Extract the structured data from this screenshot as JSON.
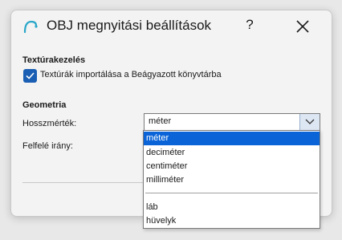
{
  "window": {
    "title": "OBJ megnyitási beállítások",
    "help_label": "?",
    "icon": "app-arc-icon",
    "close_icon": "close-icon"
  },
  "textures": {
    "heading": "Textúrakezelés",
    "checkbox_label": "Textúrák importálása a Beágyazott könyvtárba",
    "checked": true
  },
  "geometry": {
    "heading": "Geometria",
    "units_label": "Hosszmérték:",
    "up_label": "Felfelé irány:",
    "units_value": "méter",
    "dropdown_icon": "chevron-down-icon",
    "options": [
      "méter",
      "deciméter",
      "centiméter",
      "milliméter",
      "láb",
      "hüvelyk"
    ],
    "selected_option": "méter"
  },
  "colors": {
    "accent": "#0a64d8",
    "checkbox": "#1a5fb4",
    "app_icon": "#2aa7c9"
  }
}
